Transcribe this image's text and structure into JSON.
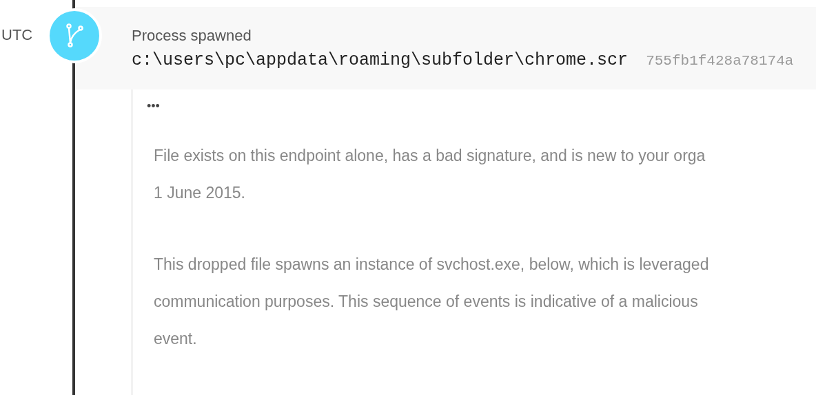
{
  "event": {
    "time_zone": "UTC",
    "title": "Process spawned",
    "path": "c:\\users\\pc\\appdata\\roaming\\subfolder\\chrome.scr",
    "hash": "755fb1f428a78174a"
  },
  "details": {
    "more_glyph": "•••",
    "paragraphs": [
      [
        "File exists on this endpoint alone, has a bad signature, and is new to your orga",
        "1 June 2015."
      ],
      [
        "This dropped file spawns an instance of svchost.exe, below, which is leveraged",
        "communication purposes. This sequence of events is indicative of a malicious",
        "event."
      ]
    ]
  }
}
